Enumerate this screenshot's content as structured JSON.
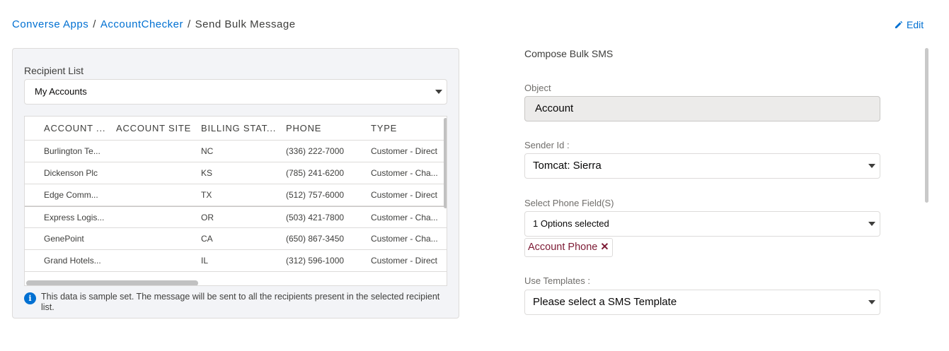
{
  "breadcrumb": {
    "items": [
      "Converse Apps",
      "AccountChecker"
    ],
    "current": "Send Bulk Message",
    "separator": "/"
  },
  "header": {
    "edit_label": "Edit",
    "edit_icon": "pencil-icon"
  },
  "recipient": {
    "label": "Recipient List",
    "selected": "My Accounts"
  },
  "table": {
    "columns": [
      "ACCOUNT ...",
      "ACCOUNT SITE",
      "BILLING STAT...",
      "PHONE",
      "TYPE"
    ],
    "rows": [
      [
        "Burlington Te...",
        "",
        "NC",
        "(336) 222-7000",
        "Customer - Direct"
      ],
      [
        "Dickenson Plc",
        "",
        "KS",
        "(785) 241-6200",
        "Customer - Cha..."
      ],
      [
        "Edge Comm...",
        "",
        "TX",
        "(512) 757-6000",
        "Customer - Direct"
      ],
      [
        "Express Logis...",
        "",
        "OR",
        "(503) 421-7800",
        "Customer - Cha..."
      ],
      [
        "GenePoint",
        "",
        "CA",
        "(650) 867-3450",
        "Customer - Cha..."
      ],
      [
        "Grand Hotels...",
        "",
        "IL",
        "(312) 596-1000",
        "Customer - Direct"
      ]
    ]
  },
  "info": {
    "icon": "info-icon",
    "text": "This data is sample set. The message will be sent to all the recipients present in the selected recipient list."
  },
  "compose": {
    "title": "Compose Bulk SMS",
    "object_label": "Object",
    "object_value": "Account",
    "sender_label": "Sender Id :",
    "sender_value": "Tomcat: Sierra",
    "phone_label": "Select Phone Field(S)",
    "phone_value": "1 Options selected",
    "phone_pill": "Account Phone",
    "template_label": "Use Templates :",
    "template_value": "Please select a SMS Template"
  },
  "colors": {
    "link": "#0070d2",
    "panel_bg": "#f3f4f7",
    "pill_text": "#7d1a34"
  }
}
